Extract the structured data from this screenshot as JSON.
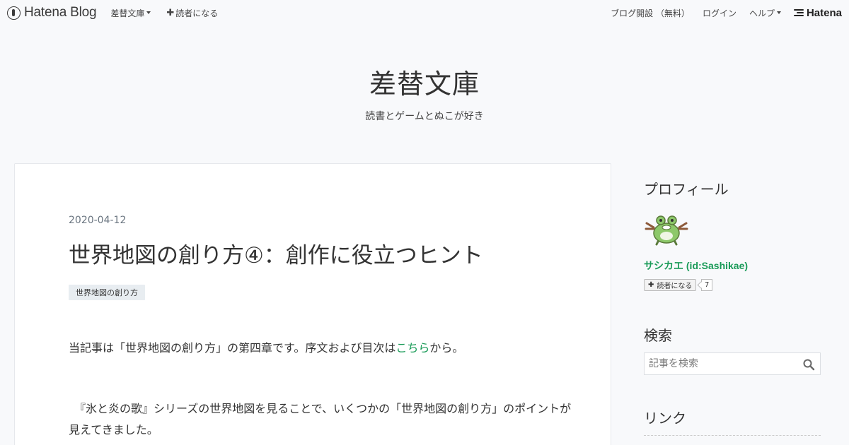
{
  "globalbar": {
    "logo_text": "Hatena Blog",
    "blog_menu_label": "差替文庫",
    "subscribe_label": "読者になる",
    "open_blog_label": "ブログ開設 （無料）",
    "login_label": "ログイン",
    "help_label": "ヘルプ",
    "hatena_label": "Hatena"
  },
  "header": {
    "title": "差替文庫",
    "description": "読書とゲームとぬこが好き"
  },
  "entry": {
    "date": "2020-04-12",
    "title": "世界地図の創り方④：創作に役立つヒント",
    "category": "世界地図の創り方",
    "para1_before": "当記事は「世界地図の創り方」の第四章です。序文および目次は",
    "para1_link": "こちら",
    "para1_after": "から。",
    "para2": "　『氷と炎の歌』シリーズの世界地図を見ることで、いくつかの「世界地図の創り方」のポイントが見えてきました。"
  },
  "sidebar": {
    "profile_heading": "プロフィール",
    "profile_name": "サシカエ (id:Sashikae)",
    "subscribe_label": "読者になる",
    "subscriber_count": "7",
    "search_heading": "検索",
    "search_placeholder": "記事を検索",
    "links_heading": "リンク"
  },
  "colors": {
    "accent_green": "#1a9b58",
    "background": "#f8f9fb"
  }
}
